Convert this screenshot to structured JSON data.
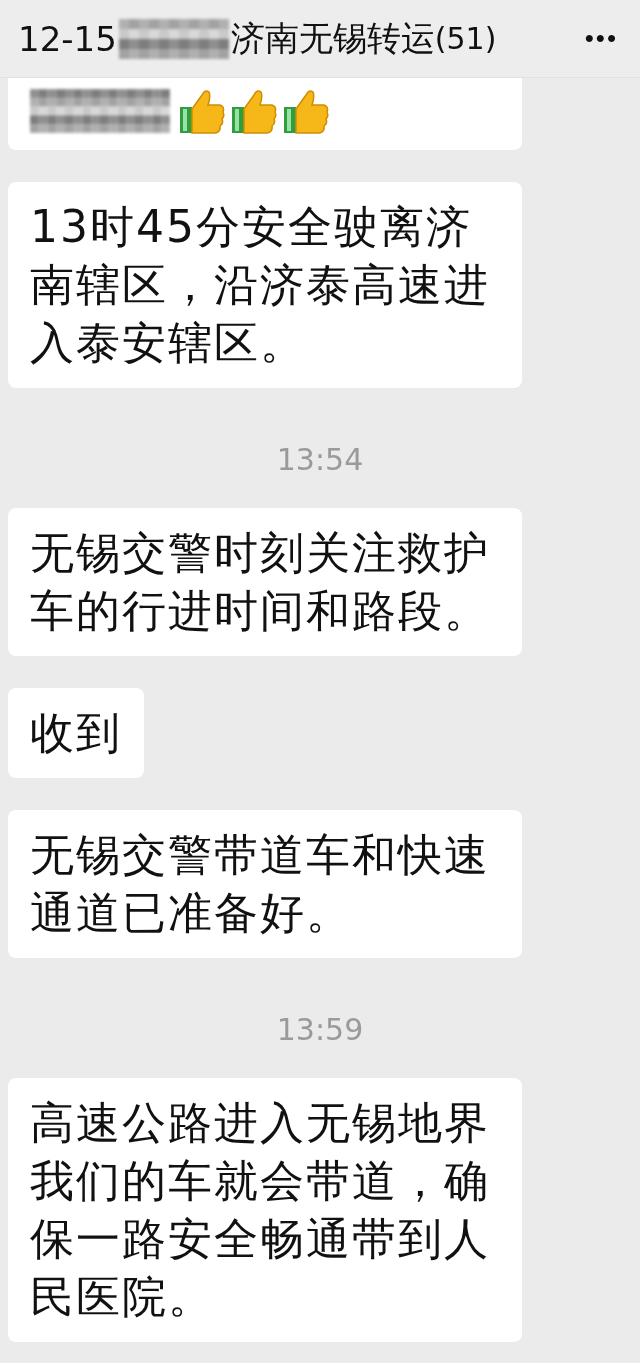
{
  "header": {
    "title_start": "12-15",
    "title_end": "济南无锡转运",
    "member_count": "(51)",
    "more": "•••"
  },
  "messages": [
    {
      "kind": "reaction"
    },
    {
      "kind": "text",
      "text": "13时45分安全驶离济南辖区，沿济泰高速进入泰安辖区。"
    },
    {
      "kind": "time",
      "text": "13:54"
    },
    {
      "kind": "text",
      "text": "无锡交警时刻关注救护车的行进时间和路段。"
    },
    {
      "kind": "text",
      "text": "收到"
    },
    {
      "kind": "text",
      "text": "无锡交警带道车和快速通道已准备好。"
    },
    {
      "kind": "time",
      "text": "13:59"
    },
    {
      "kind": "text",
      "text": "高速公路进入无锡地界我们的车就会带道，确保一路安全畅通带到人民医院。"
    }
  ]
}
